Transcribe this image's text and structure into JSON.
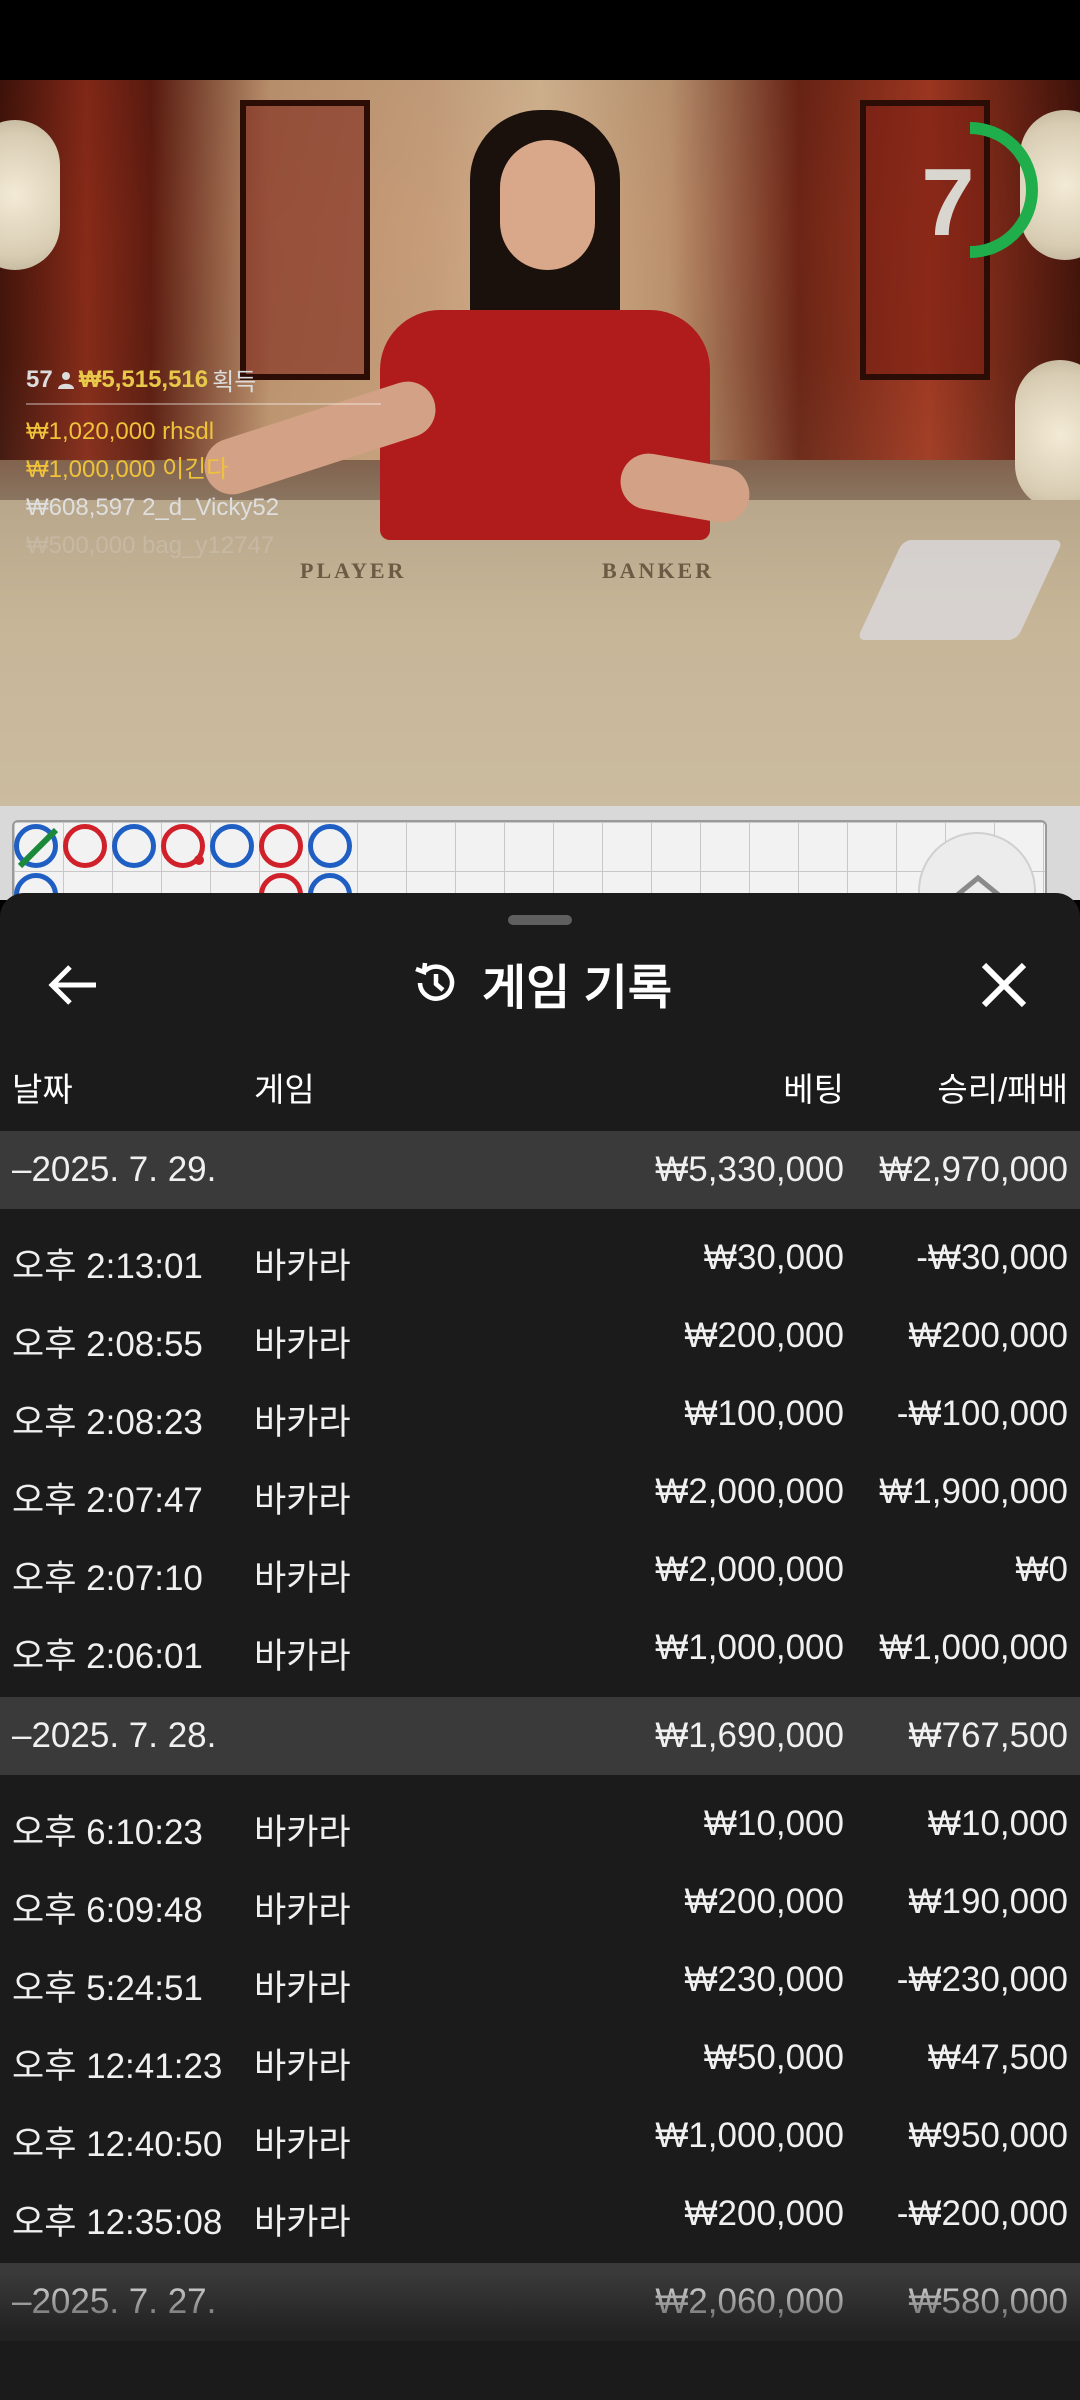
{
  "video": {
    "countdown": "7",
    "felt_player": "PLAYER",
    "felt_banker": "BANKER",
    "winners": {
      "count": "57",
      "total": "₩5,515,516",
      "total_word": "획득",
      "rows": [
        {
          "amount": "₩1,020,000",
          "name": "rhsdl"
        },
        {
          "amount": "₩1,000,000",
          "name": "이긴다"
        },
        {
          "amount": "₩608,597",
          "name": "2_d_Vicky52"
        },
        {
          "amount": "₩500,000",
          "name": "bag_y12747"
        }
      ]
    }
  },
  "sheet": {
    "title": "게임 기록",
    "columns": {
      "date": "날짜",
      "game": "게임",
      "bet": "베팅",
      "winloss": "승리/패배"
    },
    "groups": [
      {
        "date": "–2025. 7. 29.",
        "bet_total": "₩5,330,000",
        "wl_total": "₩2,970,000",
        "rows": [
          {
            "time": "오후 2:13:01",
            "game": "바카라",
            "bet": "₩30,000",
            "wl": "-₩30,000"
          },
          {
            "time": "오후 2:08:55",
            "game": "바카라",
            "bet": "₩200,000",
            "wl": "₩200,000"
          },
          {
            "time": "오후 2:08:23",
            "game": "바카라",
            "bet": "₩100,000",
            "wl": "-₩100,000"
          },
          {
            "time": "오후 2:07:47",
            "game": "바카라",
            "bet": "₩2,000,000",
            "wl": "₩1,900,000"
          },
          {
            "time": "오후 2:07:10",
            "game": "바카라",
            "bet": "₩2,000,000",
            "wl": "₩0"
          },
          {
            "time": "오후 2:06:01",
            "game": "바카라",
            "bet": "₩1,000,000",
            "wl": "₩1,000,000"
          }
        ]
      },
      {
        "date": "–2025. 7. 28.",
        "bet_total": "₩1,690,000",
        "wl_total": "₩767,500",
        "rows": [
          {
            "time": "오후 6:10:23",
            "game": "바카라",
            "bet": "₩10,000",
            "wl": "₩10,000"
          },
          {
            "time": "오후 6:09:48",
            "game": "바카라",
            "bet": "₩200,000",
            "wl": "₩190,000"
          },
          {
            "time": "오후 5:24:51",
            "game": "바카라",
            "bet": "₩230,000",
            "wl": "-₩230,000"
          },
          {
            "time": "오후 12:41:23",
            "game": "바카라",
            "bet": "₩50,000",
            "wl": "₩47,500"
          },
          {
            "time": "오후 12:40:50",
            "game": "바카라",
            "bet": "₩1,000,000",
            "wl": "₩950,000"
          },
          {
            "time": "오후 12:35:08",
            "game": "바카라",
            "bet": "₩200,000",
            "wl": "-₩200,000"
          }
        ]
      },
      {
        "date": "–2025. 7. 27.",
        "bet_total": "₩2,060,000",
        "wl_total": "₩580,000",
        "rows": []
      }
    ]
  },
  "colors": {
    "sheet_bg": "#1b1b1b",
    "group_bg": "#3a3a3a",
    "winner_gold": "#f0c23a",
    "countdown_green": "#1fae4b",
    "bead_red": "#d0202a",
    "bead_blue": "#1f5fc4"
  },
  "icons": {
    "back": "arrow-left-icon",
    "history": "history-clock-icon",
    "close": "close-x-icon",
    "expand": "chevron-up-icon"
  }
}
